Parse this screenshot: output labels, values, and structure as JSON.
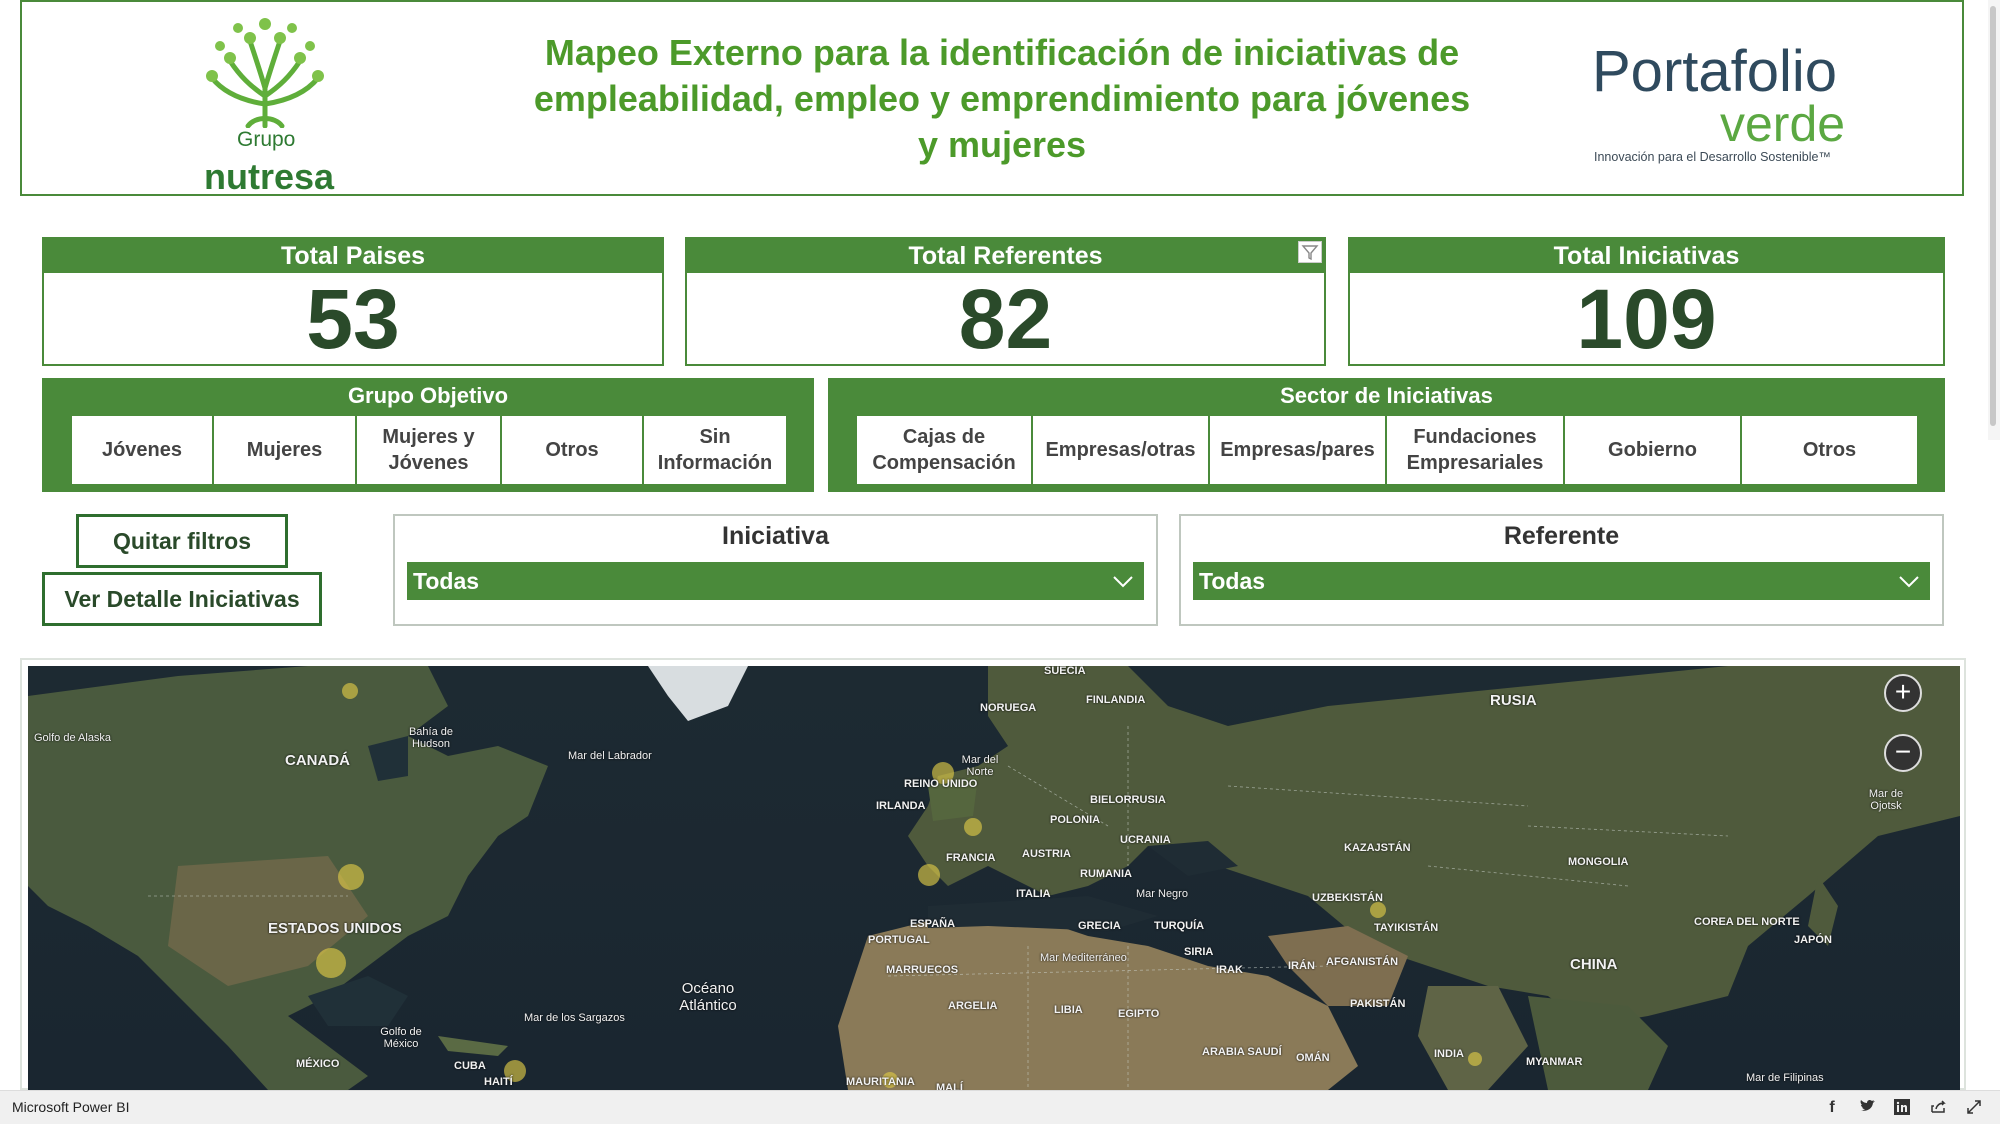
{
  "header": {
    "title": "Mapeo Externo para la identificación de iniciativas de empleabilidad, empleo y emprendimiento para jóvenes y mujeres",
    "left_logo": {
      "line1": "Grupo",
      "line2": "nutresa"
    },
    "right_logo": {
      "line1": "Portafolio",
      "line2": "verde",
      "tagline": "Innovación para el Desarrollo Sostenible™"
    }
  },
  "kpis": [
    {
      "label": "Total Paises",
      "value": "53"
    },
    {
      "label": "Total Referentes",
      "value": "82"
    },
    {
      "label": "Total Iniciativas",
      "value": "109"
    }
  ],
  "grupo_objetivo": {
    "title": "Grupo Objetivo",
    "items": [
      "Jóvenes",
      "Mujeres",
      "Mujeres y Jóvenes",
      "Otros",
      "Sin Información"
    ]
  },
  "sector": {
    "title": "Sector de Iniciativas",
    "items": [
      "Cajas de Compensación",
      "Empresas/otras",
      "Empresas/pares",
      "Fundaciones Empresariales",
      "Gobierno",
      "Otros"
    ]
  },
  "buttons": {
    "clear": "Quitar filtros",
    "detail": "Ver Detalle Iniciativas"
  },
  "dropdowns": {
    "iniciativa": {
      "label": "Iniciativa",
      "value": "Todas"
    },
    "referente": {
      "label": "Referente",
      "value": "Todas"
    }
  },
  "map": {
    "labels": {
      "canada": "CANADÁ",
      "usa": "ESTADOS UNIDOS",
      "mexico": "MÉXICO",
      "cuba": "CUBA",
      "haiti": "HAITÍ",
      "golfo_alaska": "Golfo de Alaska",
      "bahia_hudson": "Bahía de Hudson",
      "mar_labrador": "Mar del Labrador",
      "golfo_mexico": "Golfo de México",
      "mar_sargazos": "Mar de los Sargazos",
      "oceano": "Océano Atlántico",
      "suecia": "SUECIA",
      "noruega": "NORUEGA",
      "finlandia": "FINLANDIA",
      "mar_norte": "Mar del Norte",
      "reino_unido": "REINO UNIDO",
      "irlanda": "IRLANDA",
      "bielorrusia": "BIELORRUSIA",
      "polonia": "POLONIA",
      "ucrania": "UCRANIA",
      "francia": "FRANCIA",
      "austria": "AUSTRIA",
      "rumania": "RUMANIA",
      "italia": "ITALIA",
      "espana": "ESPAÑA",
      "portugal": "PORTUGAL",
      "grecia": "GRECIA",
      "turquia": "TURQUÍA",
      "mar_negro": "Mar Negro",
      "mar_mediterraneo": "Mar Mediterráneo",
      "marruecos": "MARRUECOS",
      "argelia": "ARGELIA",
      "libia": "LIBIA",
      "egipto": "EGIPTO",
      "siria": "SIRIA",
      "irak": "IRAK",
      "iran": "IRÁN",
      "afganistan": "AFGANISTÁN",
      "pakistan": "PAKISTÁN",
      "arabia": "ARABIA SAUDÍ",
      "oman": "OMÁN",
      "mauritania": "MAURITANIA",
      "mali": "MALÍ",
      "rusia": "RUSIA",
      "kazajstan": "KAZAJSTÁN",
      "uzbekistan": "UZBEKISTÁN",
      "tayikistan": "TAYIKISTÁN",
      "mongolia": "MONGOLIA",
      "china": "CHINA",
      "india": "INDIA",
      "myanmar": "MYANMAR",
      "corea": "COREA DEL NORTE",
      "japon": "JAPÓN",
      "mar_ojotsk": "Mar de Ojotsk",
      "mar_filipinas": "Mar de Filipinas"
    },
    "zoom_in": "+",
    "zoom_out": "−"
  },
  "bottom_bar": {
    "app_name": "Microsoft Power BI"
  }
}
